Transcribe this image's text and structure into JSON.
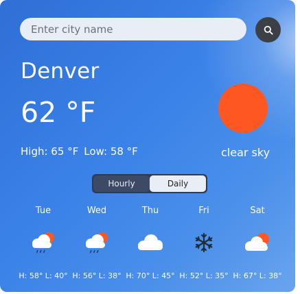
{
  "search": {
    "placeholder": "Enter city name",
    "value": "",
    "button_icon": "search-icon"
  },
  "current": {
    "city": "Denver",
    "temperature": "62 °F",
    "high_text": "High: 65 °F",
    "low_text": "Low: 58 °F",
    "condition": "clear sky",
    "condition_icon": "sun-icon",
    "sun_color": "#ff5722"
  },
  "toggle": {
    "options": [
      "Hourly",
      "Daily"
    ],
    "selected": "Daily"
  },
  "forecast": {
    "days": [
      {
        "day": "Tue",
        "icon": "rain-cloud-sun-icon",
        "range": "H: 58° L: 40°"
      },
      {
        "day": "Wed",
        "icon": "rain-cloud-sun-icon",
        "range": "H: 56° L: 38°"
      },
      {
        "day": "Thu",
        "icon": "cloud-icon",
        "range": "H: 70° L: 45°"
      },
      {
        "day": "Fri",
        "icon": "snowflake-icon",
        "range": "H: 52° L: 35°"
      },
      {
        "day": "Sat",
        "icon": "cloud-sun-icon",
        "range": "H: 67° L: 38°"
      }
    ]
  },
  "colors": {
    "background": "#3b82e8",
    "search_button": "#3c3f45",
    "sun": "#ff5722",
    "toggle_bg": "#2e3a52",
    "toggle_selected": "#e8edf6"
  }
}
